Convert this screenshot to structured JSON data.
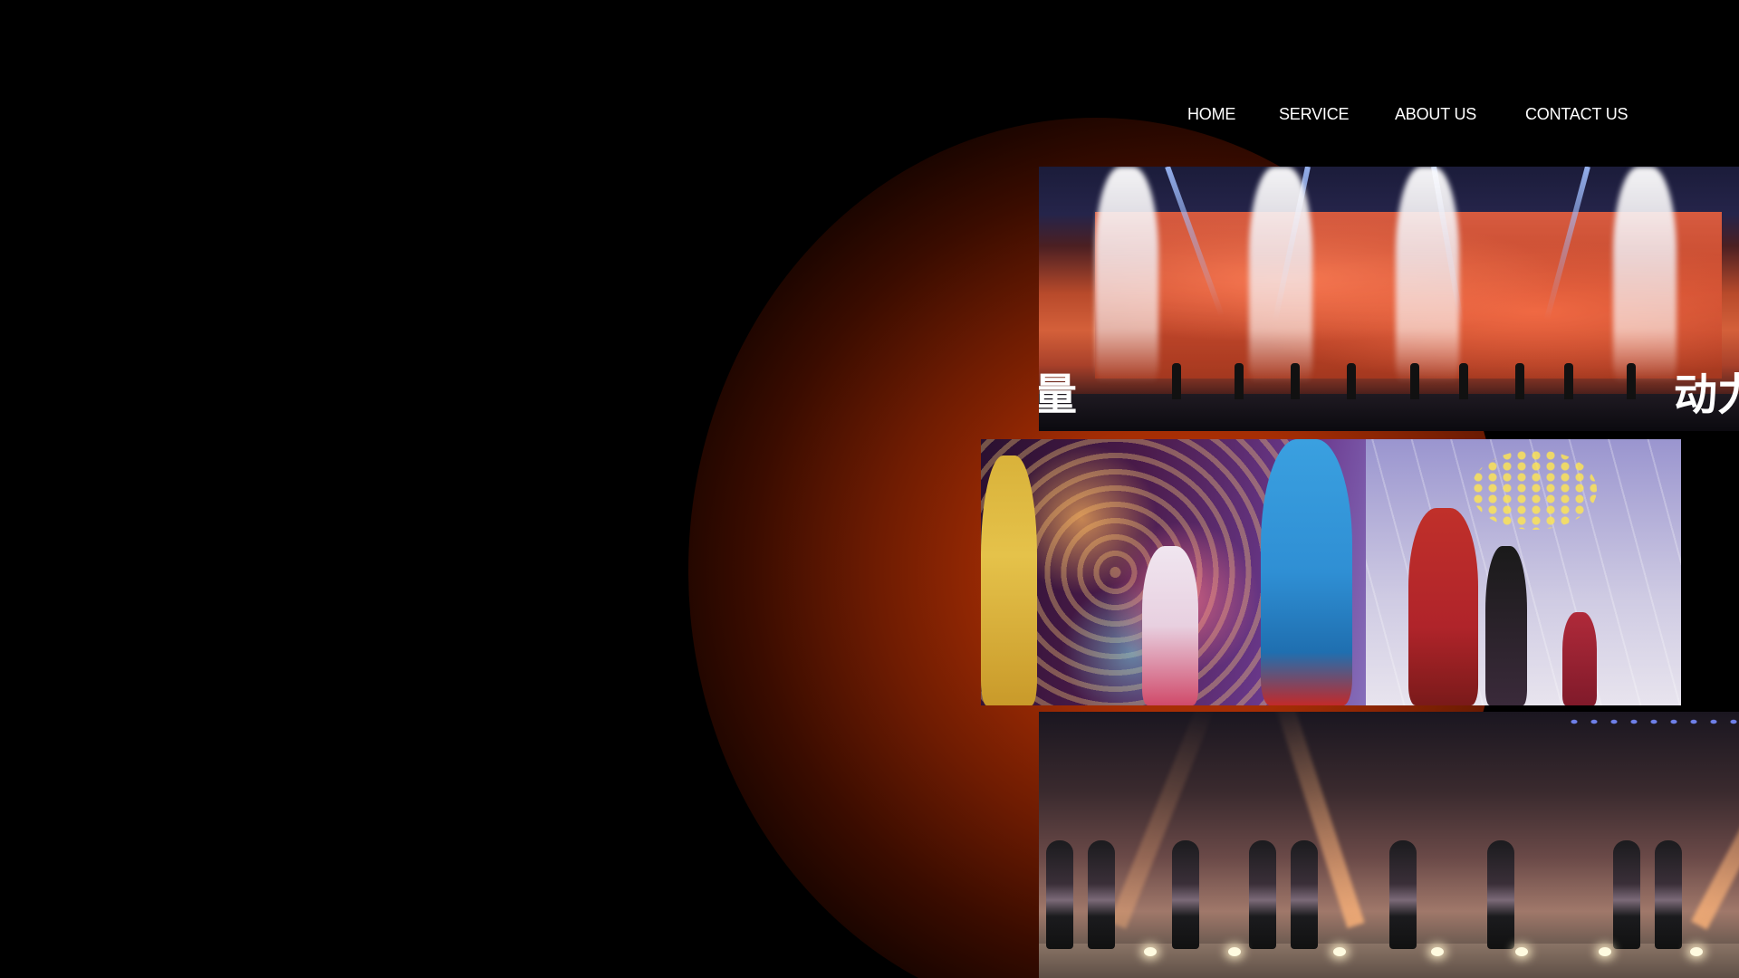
{
  "nav": {
    "items": [
      {
        "label": "HOME"
      },
      {
        "label": "SERVICE"
      },
      {
        "label": "ABOUT US"
      },
      {
        "label": "CONTACT US"
      }
    ]
  },
  "photos": [
    {
      "overlay_left": "量",
      "overlay_right": "动力"
    }
  ],
  "colors": {
    "background": "#000000",
    "glow": "#c13a05",
    "nav_text": "#ffffff"
  }
}
